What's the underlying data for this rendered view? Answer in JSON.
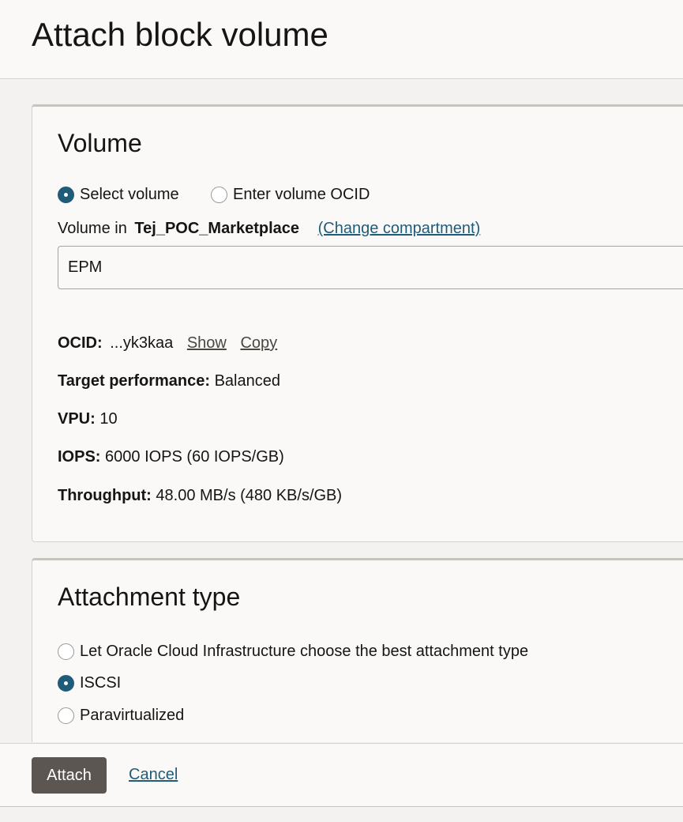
{
  "page": {
    "title": "Attach block volume"
  },
  "volume_section": {
    "title": "Volume",
    "radio_select_volume": "Select volume",
    "radio_enter_ocid": "Enter volume OCID",
    "volume_in_prefix": "Volume in",
    "compartment": "Tej_POC_Marketplace",
    "change_compartment": "(Change compartment)",
    "selected_volume": "EPM",
    "ocid_label": "OCID:",
    "ocid_value": "...yk3kaa",
    "show_link": "Show",
    "copy_link": "Copy",
    "target_performance_label": "Target performance:",
    "target_performance_value": "Balanced",
    "vpu_label": "VPU:",
    "vpu_value": "10",
    "iops_label": "IOPS:",
    "iops_value": "6000 IOPS (60 IOPS/GB)",
    "throughput_label": "Throughput:",
    "throughput_value": "48.00 MB/s (480 KB/s/GB)"
  },
  "attachment_section": {
    "title": "Attachment type",
    "options": [
      {
        "label": "Let Oracle Cloud Infrastructure choose the best attachment type",
        "selected": false
      },
      {
        "label": "ISCSI",
        "selected": true
      },
      {
        "label": "Paravirtualized",
        "selected": false
      }
    ]
  },
  "footer": {
    "attach_label": "Attach",
    "cancel_label": "Cancel"
  },
  "colors": {
    "accent": "#1f5c7a",
    "primary_button": "#5b5652"
  }
}
